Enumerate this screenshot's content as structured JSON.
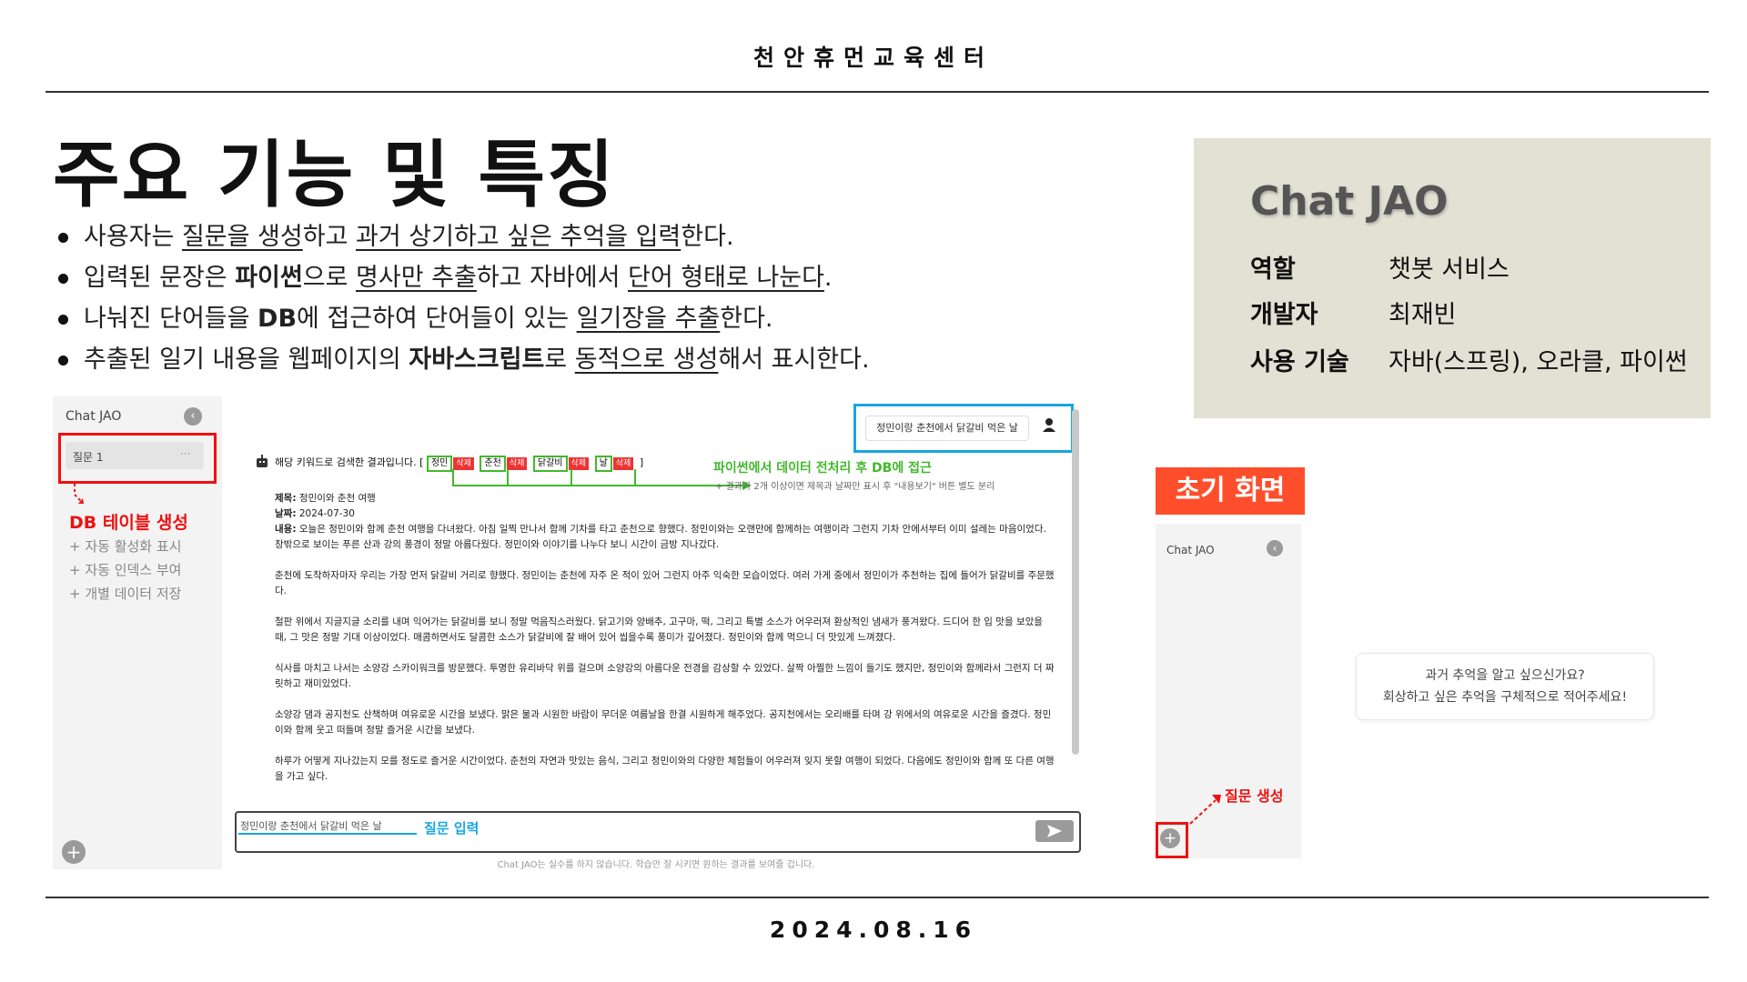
{
  "header": {
    "org": "천안휴먼교육센터"
  },
  "slide": {
    "title": "주요 기능 및 특징",
    "bullets": [
      {
        "p1": "사용자는 ",
        "u1": "질문을 생성",
        "p2": "하고 ",
        "u2": "과거 상기하고 싶은 추억을 입력",
        "p3": "한다."
      },
      {
        "p1": "입력된 문장은 ",
        "b1": "파이썬",
        "p2": "으로 ",
        "u1": "명사만 추출",
        "p3": "하고 자바에서 ",
        "u2": "단어 형태로 나눈다",
        "p4": "."
      },
      {
        "p1": "나눠진 단어들을 ",
        "b1": "DB",
        "p2": "에 접근하여 단어들이 있는 ",
        "u1": "일기장을 추출",
        "p3": "한다."
      },
      {
        "p1": "추출된 일기 내용을 웹페이지의 ",
        "b1": "자바스크립트",
        "p2": "로 ",
        "u1": "동적으로 생성",
        "p3": "해서 표시한다."
      }
    ]
  },
  "info_box": {
    "title": "Chat JAO",
    "rows": [
      {
        "key": "역할",
        "value": "챗봇 서비스"
      },
      {
        "key": "개발자",
        "value": "최재빈"
      },
      {
        "key": "사용 기술",
        "value": "자바(스프링), 오라클, 파이썬"
      }
    ]
  },
  "screenshot_main": {
    "sidebar_title": "Chat JAO",
    "collapse_icon": "chevron-left-icon",
    "question_item": "질문 1",
    "question_more": "···",
    "annotation_db": "DB 테이블 생성",
    "annotation_db_notes": [
      "+ 자동 활성화 표시",
      "+ 자동 인덱스 부여",
      "+ 개별 데이터 저장"
    ],
    "user_message": "정민이랑 춘천에서 닭갈비 먹은 날",
    "result_intro": "해당 키워드로 검색한 결과입니다. [",
    "result_outro": "]",
    "keywords": [
      "정민",
      "춘천",
      "닭갈비",
      "날"
    ],
    "delete_label": "삭제",
    "annotation_python": "파이썬에서 데이터 전처리 후 DB에 접근",
    "annotation_python_note": "+ 결과가 2개 이상이면 제목과 날짜만 표시 후 \"내용보기\" 버튼 별도 분리",
    "diary": {
      "title_label": "제목:",
      "title": "정민이와 춘천 여행",
      "date_label": "날짜:",
      "date": "2024-07-30",
      "content_label": "내용:",
      "paragraphs": [
        "오늘은 정민이와 함께 춘천 여행을 다녀왔다. 아침 일찍 만나서 함께 기차를 타고 춘천으로 향했다. 정민이와는 오랜만에 함께하는 여행이라 그런지 기차 안에서부터 이미 설레는 마음이었다. 창밖으로 보이는 푸른 산과 강의 풍경이 정말 아름다웠다. 정민이와 이야기를 나누다 보니 시간이 금방 지나갔다.",
        "춘천에 도착하자마자 우리는 가장 먼저 닭갈비 거리로 향했다. 정민이는 춘천에 자주 온 적이 있어 그런지 아주 익숙한 모습이었다. 여러 가게 중에서 정민이가 추천하는 집에 들어가 닭갈비를 주문했다.",
        "철판 위에서 지글지글 소리를 내며 익어가는 닭갈비를 보니 정말 먹음직스러웠다. 닭고기와 양배추, 고구마, 떡, 그리고 특별 소스가 어우러져 환상적인 냄새가 풍겨왔다. 드디어 한 입 맛을 보았을 때, 그 맛은 정말 기대 이상이었다. 매콤하면서도 달콤한 소스가 닭갈비에 잘 배어 있어 씹을수록 풍미가 깊어졌다. 정민이와 함께 먹으니 더 맛있게 느껴졌다.",
        "식사를 마치고 나서는 소양강 스카이워크를 방문했다. 투명한 유리바닥 위를 걸으며 소양강의 아름다운 전경을 감상할 수 있었다. 살짝 아찔한 느낌이 들기도 했지만, 정민이와 함께라서 그런지 더 짜릿하고 재미있었다.",
        "소양강 댐과 공지천도 산책하며 여유로운 시간을 보냈다. 맑은 물과 시원한 바람이 무더운 여름날을 한결 시원하게 해주었다. 공지천에서는 오리배를 타며 강 위에서의 여유로운 시간을 즐겼다. 정민이와 함께 웃고 떠들며 정말 즐거운 시간을 보냈다.",
        "하루가 어떻게 지나갔는지 모를 정도로 즐거운 시간이었다. 춘천의 자연과 맛있는 음식, 그리고 정민이와의 다양한 체험들이 어우러져 잊지 못할 여행이 되었다. 다음에도 정민이와 함께 또 다른 여행을 가고 싶다."
      ]
    },
    "input_value": "정민이랑 춘천에서 닭갈비 먹은 날",
    "annotation_input": "질문 입력",
    "footer_note": "Chat JAO는 실수를 하지 않습니다. 학습만 잘 시키면 원하는 결과를 보여줄 겁니다.",
    "add_icon": "plus-icon",
    "send_icon": "send-icon"
  },
  "screenshot_initial": {
    "label": "초기 화면",
    "sidebar_title": "Chat JAO",
    "greeting_line1": "과거 추억을 알고 싶으신가요?",
    "greeting_line2": "회상하고 싶은 추억을 구체적으로 적어주세요!",
    "annotation_create": "질문 생성"
  },
  "footer": {
    "date": "2024.08.16"
  },
  "colors": {
    "accent_red": "#e11111",
    "highlight_blue": "#19a6e0",
    "highlight_green": "#43b82d",
    "label_orange": "#ff4e2b",
    "info_bg": "#e3e0d4"
  }
}
